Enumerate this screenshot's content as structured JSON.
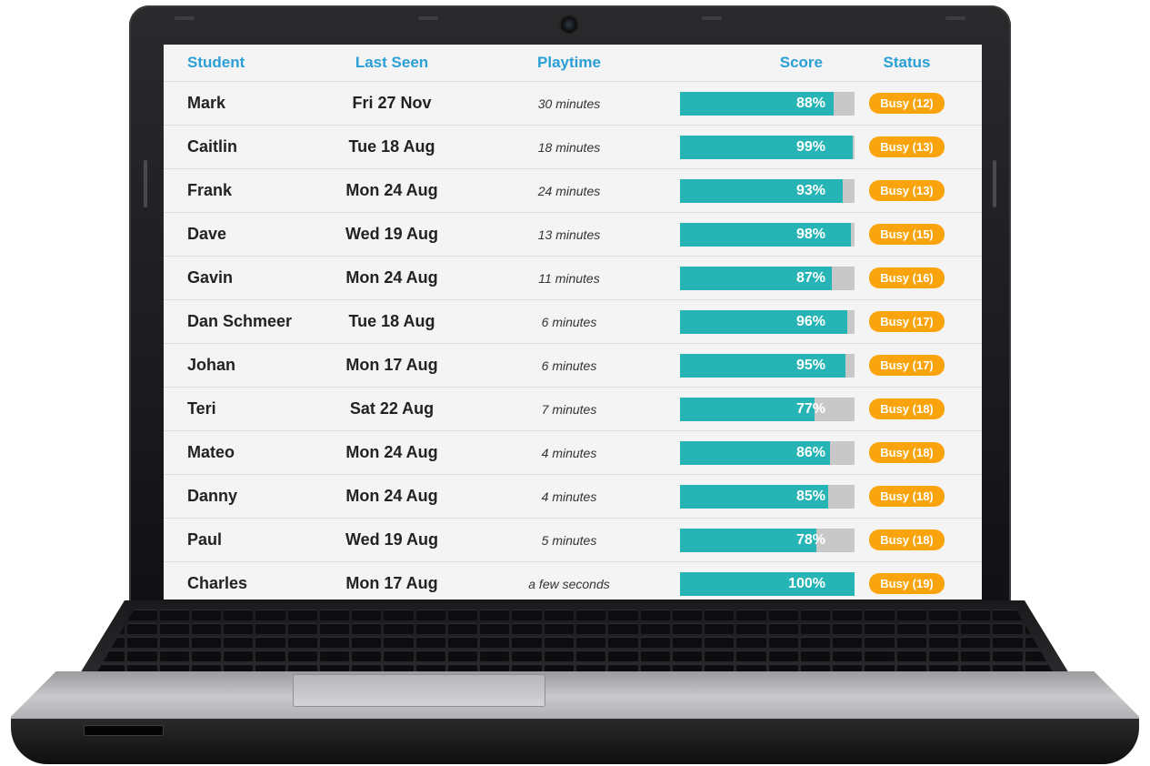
{
  "table": {
    "headers": {
      "student": "Student",
      "last_seen": "Last Seen",
      "playtime": "Playtime",
      "score": "Score",
      "status": "Status"
    },
    "rows": [
      {
        "student": "Mark",
        "last_seen": "Fri 27 Nov",
        "playtime": "30 minutes",
        "score": 88,
        "score_label": "88%",
        "status": "Busy (12)"
      },
      {
        "student": "Caitlin",
        "last_seen": "Tue 18 Aug",
        "playtime": "18 minutes",
        "score": 99,
        "score_label": "99%",
        "status": "Busy (13)"
      },
      {
        "student": "Frank",
        "last_seen": "Mon 24 Aug",
        "playtime": "24 minutes",
        "score": 93,
        "score_label": "93%",
        "status": "Busy (13)"
      },
      {
        "student": "Dave",
        "last_seen": "Wed 19 Aug",
        "playtime": "13 minutes",
        "score": 98,
        "score_label": "98%",
        "status": "Busy (15)"
      },
      {
        "student": "Gavin",
        "last_seen": "Mon 24 Aug",
        "playtime": "11 minutes",
        "score": 87,
        "score_label": "87%",
        "status": "Busy (16)"
      },
      {
        "student": "Dan Schmeer",
        "last_seen": "Tue 18 Aug",
        "playtime": "6 minutes",
        "score": 96,
        "score_label": "96%",
        "status": "Busy (17)"
      },
      {
        "student": "Johan",
        "last_seen": "Mon 17 Aug",
        "playtime": "6 minutes",
        "score": 95,
        "score_label": "95%",
        "status": "Busy (17)"
      },
      {
        "student": "Teri",
        "last_seen": "Sat 22 Aug",
        "playtime": "7 minutes",
        "score": 77,
        "score_label": "77%",
        "status": "Busy (18)"
      },
      {
        "student": "Mateo",
        "last_seen": "Mon 24 Aug",
        "playtime": "4 minutes",
        "score": 86,
        "score_label": "86%",
        "status": "Busy (18)"
      },
      {
        "student": "Danny",
        "last_seen": "Mon 24 Aug",
        "playtime": "4 minutes",
        "score": 85,
        "score_label": "85%",
        "status": "Busy (18)"
      },
      {
        "student": "Paul",
        "last_seen": "Wed 19 Aug",
        "playtime": "5 minutes",
        "score": 78,
        "score_label": "78%",
        "status": "Busy (18)"
      },
      {
        "student": "Charles",
        "last_seen": "Mon 17 Aug",
        "playtime": "a few seconds",
        "score": 100,
        "score_label": "100%",
        "status": "Busy (19)"
      }
    ]
  },
  "colors": {
    "header_text": "#2a9fd6",
    "score_fill": "#26b5b4",
    "score_track": "#c8c8c8",
    "status_badge": "#f9a40d"
  }
}
